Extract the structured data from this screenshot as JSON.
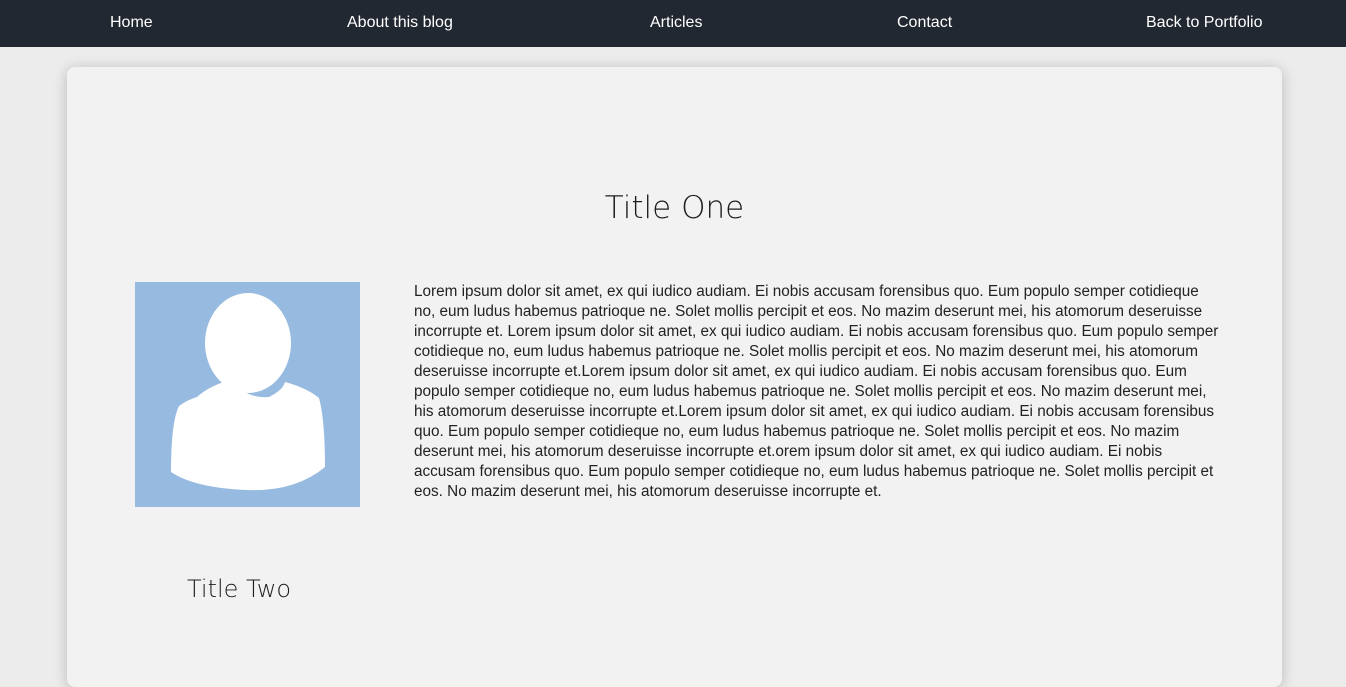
{
  "nav": {
    "items": [
      {
        "label": "Home"
      },
      {
        "label": "About this blog"
      },
      {
        "label": "Articles"
      },
      {
        "label": "Contact"
      },
      {
        "label": "Back to Portfolio"
      }
    ]
  },
  "colors": {
    "nav_background": "#222831",
    "page_background": "#ececec",
    "card_background": "#f2f2f2",
    "avatar_background": "#97bbe0"
  },
  "article": {
    "title_one": "Title One",
    "avatar_icon": "user-silhouette-icon",
    "body": "Lorem ipsum dolor sit amet, ex qui iudico audiam. Ei nobis accusam forensibus quo. Eum populo semper cotidieque no, eum ludus habemus patrioque ne. Solet mollis percipit et eos. No mazim deserunt mei, his atomorum deseruisse incorrupte et. Lorem ipsum dolor sit amet, ex qui iudico audiam. Ei nobis accusam forensibus quo. Eum populo semper cotidieque no, eum ludus habemus patrioque ne. Solet mollis percipit et eos. No mazim deserunt mei, his atomorum deseruisse incorrupte et.Lorem ipsum dolor sit amet, ex qui iudico audiam. Ei nobis accusam forensibus quo. Eum populo semper cotidieque no, eum ludus habemus patrioque ne. Solet mollis percipit et eos. No mazim deserunt mei, his atomorum deseruisse incorrupte et.Lorem ipsum dolor sit amet, ex qui iudico audiam. Ei nobis accusam forensibus quo. Eum populo semper cotidieque no, eum ludus habemus patrioque ne. Solet mollis percipit et eos. No mazim deserunt mei, his atomorum deseruisse incorrupte et.orem ipsum dolor sit amet, ex qui iudico audiam. Ei nobis accusam forensibus quo. Eum populo semper cotidieque no, eum ludus habemus patrioque ne. Solet mollis percipit et eos. No mazim deserunt mei, his atomorum deseruisse incorrupte et.",
    "title_two": "Title Two"
  }
}
